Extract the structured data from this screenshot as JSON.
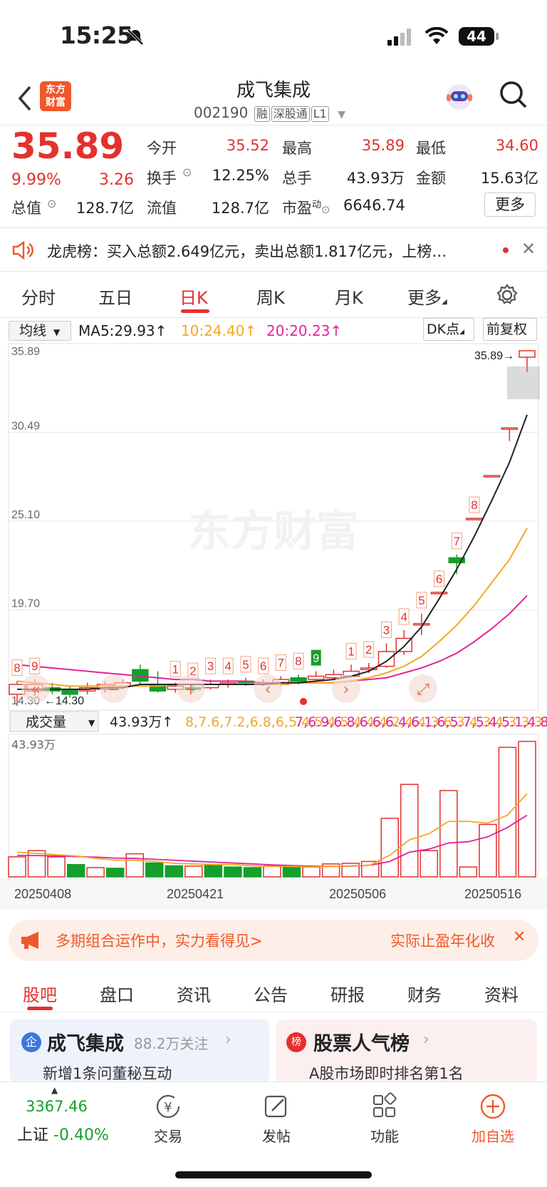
{
  "status": {
    "time": "15:25",
    "battery": "44"
  },
  "header": {
    "title": "成飞集成",
    "code": "002190",
    "tags": [
      "融",
      "深股通",
      "L1"
    ],
    "logo": "东方\n财富"
  },
  "quote": {
    "price": "35.89",
    "change_pct": "9.99%",
    "change": "3.26",
    "today_open_label": "今开",
    "today_open": "35.52",
    "high_label": "最高",
    "high": "35.89",
    "low_label": "最低",
    "low": "34.60",
    "turnover_label": "换手",
    "turnover": "12.25%",
    "volume_label": "总手",
    "volume": "43.93万",
    "amount_label": "金额",
    "amount": "15.63亿",
    "mktcap_label": "总值",
    "mktcap": "128.7亿",
    "float_label": "流值",
    "float": "128.7亿",
    "pe_label": "市盈",
    "pe_sup": "动",
    "pe": "6646.74",
    "more_label": "更多"
  },
  "notice": {
    "text": "龙虎榜：买入总额2.649亿元，卖出总额1.817亿元，上榜…"
  },
  "tabs": [
    "分时",
    "五日",
    "日K",
    "周K",
    "月K",
    "更多"
  ],
  "kline_toolbar": {
    "indicator": "均线",
    "ma5": "MA5:29.93↑",
    "ma10": "10:24.40↑",
    "ma20": "20:20.23↑",
    "dk": "DK点",
    "adjust": "前复权"
  },
  "chart_data": {
    "type": "candlestick",
    "price_axis_labels": [
      "35.89",
      "30.49",
      "25.10",
      "19.70",
      "14.30"
    ],
    "ylim": [
      14.3,
      35.89
    ],
    "high_marker": "35.89→",
    "low_marker": "←14.30",
    "watermark": "东方财富",
    "dates": [
      "20250408",
      "20250421",
      "20250506",
      "20250516"
    ],
    "candles": [
      {
        "o": 15.0,
        "c": 15.6,
        "h": 15.8,
        "l": 14.3
      },
      {
        "o": 15.2,
        "c": 15.6,
        "h": 15.9,
        "l": 14.9
      },
      {
        "o": 15.4,
        "c": 15.2,
        "h": 15.7,
        "l": 15.0
      },
      {
        "o": 15.3,
        "c": 15.0,
        "h": 15.5,
        "l": 14.8
      },
      {
        "o": 15.2,
        "c": 15.4,
        "h": 15.7,
        "l": 15.0
      },
      {
        "o": 15.3,
        "c": 15.6,
        "h": 15.8,
        "l": 15.1
      },
      {
        "o": 15.5,
        "c": 15.7,
        "h": 15.9,
        "l": 15.3
      },
      {
        "o": 16.5,
        "c": 15.8,
        "h": 16.8,
        "l": 15.6
      },
      {
        "o": 15.6,
        "c": 15.2,
        "h": 16.4,
        "l": 15.1
      },
      {
        "o": 15.3,
        "c": 15.5,
        "h": 15.7,
        "l": 15.1
      },
      {
        "o": 15.4,
        "c": 15.3,
        "h": 15.6,
        "l": 15.1
      },
      {
        "o": 15.4,
        "c": 15.6,
        "h": 15.9,
        "l": 15.3
      },
      {
        "o": 15.6,
        "c": 15.7,
        "h": 15.9,
        "l": 15.4
      },
      {
        "o": 15.8,
        "c": 15.7,
        "h": 16.0,
        "l": 15.5
      },
      {
        "o": 15.7,
        "c": 15.6,
        "h": 15.9,
        "l": 15.5
      },
      {
        "o": 15.6,
        "c": 15.9,
        "h": 16.1,
        "l": 15.5
      },
      {
        "o": 16.0,
        "c": 15.8,
        "h": 16.2,
        "l": 15.6
      },
      {
        "o": 15.9,
        "c": 16.1,
        "h": 16.4,
        "l": 15.8
      },
      {
        "o": 16.0,
        "c": 16.2,
        "h": 16.5,
        "l": 15.9
      },
      {
        "o": 16.1,
        "c": 16.4,
        "h": 16.8,
        "l": 16.0
      },
      {
        "o": 16.5,
        "c": 16.6,
        "h": 16.9,
        "l": 16.3
      },
      {
        "o": 16.7,
        "c": 17.6,
        "h": 18.1,
        "l": 16.6
      },
      {
        "o": 17.6,
        "c": 18.4,
        "h": 18.9,
        "l": 17.4
      },
      {
        "o": 19.3,
        "c": 19.3,
        "h": 19.9,
        "l": 18.6
      },
      {
        "o": 21.2,
        "c": 21.2,
        "h": 21.2,
        "l": 21.2
      },
      {
        "o": 23.3,
        "c": 23.0,
        "h": 23.5,
        "l": 22.3
      },
      {
        "o": 25.7,
        "c": 25.7,
        "h": 25.7,
        "l": 25.7
      },
      {
        "o": 28.3,
        "c": 28.3,
        "h": 28.3,
        "l": 28.3
      },
      {
        "o": 31.2,
        "c": 31.2,
        "h": 31.2,
        "l": 30.4
      },
      {
        "o": 35.5,
        "c": 35.89,
        "h": 35.89,
        "l": 34.6
      }
    ],
    "counter_labels": [
      {
        "i": 0,
        "t": "8"
      },
      {
        "i": 1,
        "t": "9"
      },
      {
        "i": 9,
        "t": "1"
      },
      {
        "i": 10,
        "t": "2"
      },
      {
        "i": 11,
        "t": "3"
      },
      {
        "i": 12,
        "t": "4"
      },
      {
        "i": 13,
        "t": "5"
      },
      {
        "i": 14,
        "t": "6"
      },
      {
        "i": 15,
        "t": "7"
      },
      {
        "i": 16,
        "t": "8"
      },
      {
        "i": 17,
        "t": "9",
        "green": true
      },
      {
        "i": 19,
        "t": "1"
      },
      {
        "i": 20,
        "t": "2"
      },
      {
        "i": 21,
        "t": "3"
      },
      {
        "i": 22,
        "t": "4"
      },
      {
        "i": 23,
        "t": "5"
      },
      {
        "i": 24,
        "t": "6"
      },
      {
        "i": 25,
        "t": "7"
      },
      {
        "i": 26,
        "t": "8"
      }
    ],
    "ma5": [
      15.3,
      15.3,
      15.3,
      15.3,
      15.3,
      15.4,
      15.4,
      15.6,
      15.6,
      15.6,
      15.6,
      15.6,
      15.6,
      15.6,
      15.6,
      15.7,
      15.7,
      15.8,
      15.9,
      16.1,
      16.4,
      17.0,
      17.9,
      19.1,
      20.8,
      22.6,
      24.6,
      26.8,
      29.1,
      32.0
    ],
    "ma10": [
      15.8,
      15.7,
      15.6,
      15.5,
      15.5,
      15.5,
      15.5,
      15.5,
      15.5,
      15.6,
      15.6,
      15.6,
      15.6,
      15.6,
      15.6,
      15.6,
      15.7,
      15.7,
      15.7,
      15.8,
      16.0,
      16.3,
      16.7,
      17.3,
      18.2,
      19.2,
      20.4,
      21.8,
      23.2,
      25.1
    ],
    "ma20": [
      16.8,
      16.7,
      16.6,
      16.5,
      16.4,
      16.3,
      16.2,
      16.1,
      16.0,
      15.9,
      15.9,
      15.8,
      15.8,
      15.8,
      15.7,
      15.7,
      15.7,
      15.7,
      15.7,
      15.8,
      15.9,
      16.0,
      16.3,
      16.6,
      17.0,
      17.5,
      18.2,
      19.0,
      19.9,
      21.0
    ],
    "volume": {
      "indicator": "成交量",
      "vol": "43.93万↑",
      "ma1": [
        8.0,
        7.6,
        7.2,
        6.8,
        6.0,
        5.4,
        5.4,
        5.0,
        4.4,
        4.2,
        4.0,
        4.0,
        3.6,
        3.4,
        3.4,
        3.3,
        3.4,
        3.6,
        3.8,
        7.0,
        12.0,
        14.0,
        18.0,
        18.0,
        17.4,
        20.0,
        27.0
      ],
      "ma2": [
        7.0,
        6.9,
        6.8,
        6.6,
        6.4,
        6.1,
        6.0,
        5.7,
        5.4,
        5.1,
        4.8,
        4.5,
        4.2,
        3.9,
        3.7,
        3.5,
        3.4,
        3.5,
        3.8,
        5.0,
        8.0,
        9.0,
        11.0,
        11.4,
        13.0,
        16.0,
        20.0
      ],
      "top_label": "43.93万",
      "max": 43.93,
      "values": [
        6.5,
        8.5,
        6.5,
        4.0,
        3.0,
        2.8,
        7.5,
        4.5,
        3.6,
        3.5,
        3.8,
        3.2,
        3.0,
        3.6,
        3.4,
        3.2,
        4.2,
        4.4,
        5.0,
        19.0,
        30.0,
        8.5,
        28.0,
        3.2,
        17.0,
        42.0,
        43.93
      ],
      "up": [
        true,
        true,
        true,
        false,
        true,
        false,
        true,
        false,
        false,
        true,
        false,
        false,
        false,
        true,
        false,
        true,
        true,
        true,
        true,
        true,
        true,
        true,
        true,
        true,
        true,
        true,
        true
      ]
    }
  },
  "banner": {
    "text": "多期组合运作中，实力看得见>",
    "right": "实际止盈年化收"
  },
  "bottom_tabs": [
    "股吧",
    "盘口",
    "资讯",
    "公告",
    "研报",
    "财务",
    "资料"
  ],
  "cards": [
    {
      "badge": "企",
      "title": "成飞集成",
      "sub1": "88.2万关注",
      "line2": "新增1条问董秘互动"
    },
    {
      "badge": "榜",
      "title": "股票人气榜",
      "line2": "A股市场即时排名第1名"
    }
  ],
  "bottom_nav": {
    "index_value": "3367.46",
    "index_name": "上证",
    "index_change": "-0.40%",
    "items": [
      "交易",
      "发帖",
      "功能",
      "加自选"
    ]
  }
}
